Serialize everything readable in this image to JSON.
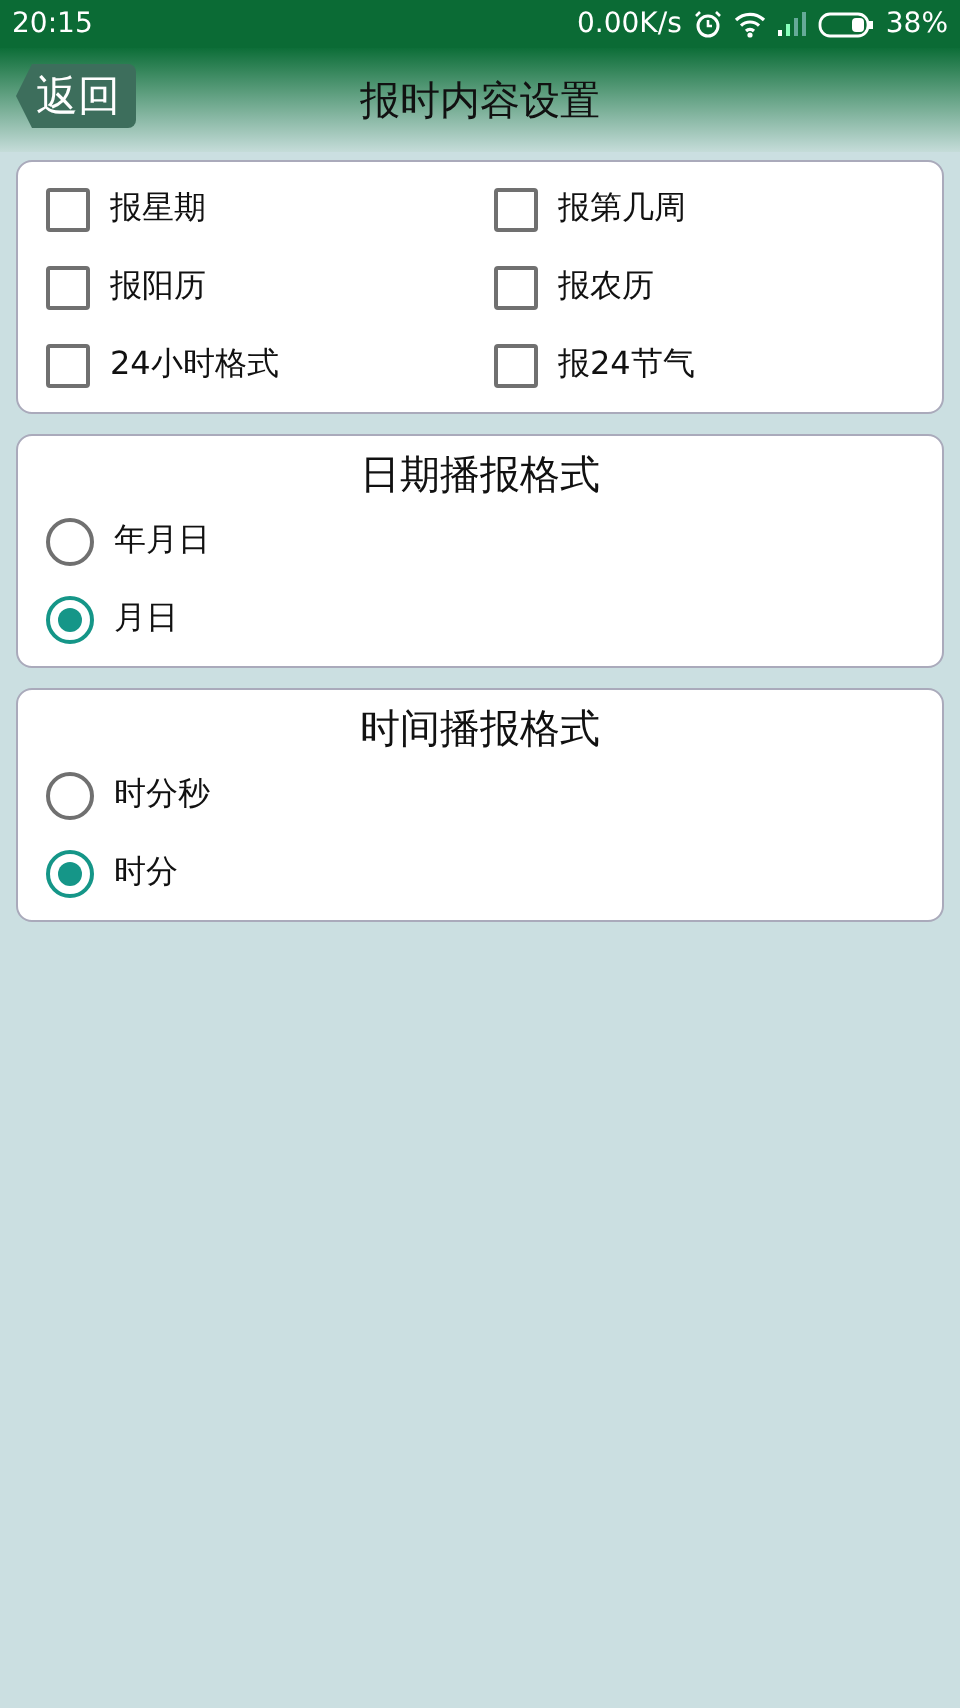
{
  "status_bar": {
    "time": "20:15",
    "speed": "0.00K/s",
    "battery": "38%"
  },
  "header": {
    "back": "返回",
    "title": "报时内容设置"
  },
  "options": [
    {
      "label": "报星期",
      "checked": false
    },
    {
      "label": "报第几周",
      "checked": false
    },
    {
      "label": "报阳历",
      "checked": false
    },
    {
      "label": "报农历",
      "checked": false
    },
    {
      "label": "24小时格式",
      "checked": false
    },
    {
      "label": "报24节气",
      "checked": false
    }
  ],
  "groups": [
    {
      "title": "日期播报格式",
      "choices": [
        {
          "label": "年月日",
          "selected": false
        },
        {
          "label": "月日",
          "selected": true
        }
      ]
    },
    {
      "title": "时间播报格式",
      "choices": [
        {
          "label": "时分秒",
          "selected": false
        },
        {
          "label": "时分",
          "selected": true
        }
      ]
    }
  ]
}
